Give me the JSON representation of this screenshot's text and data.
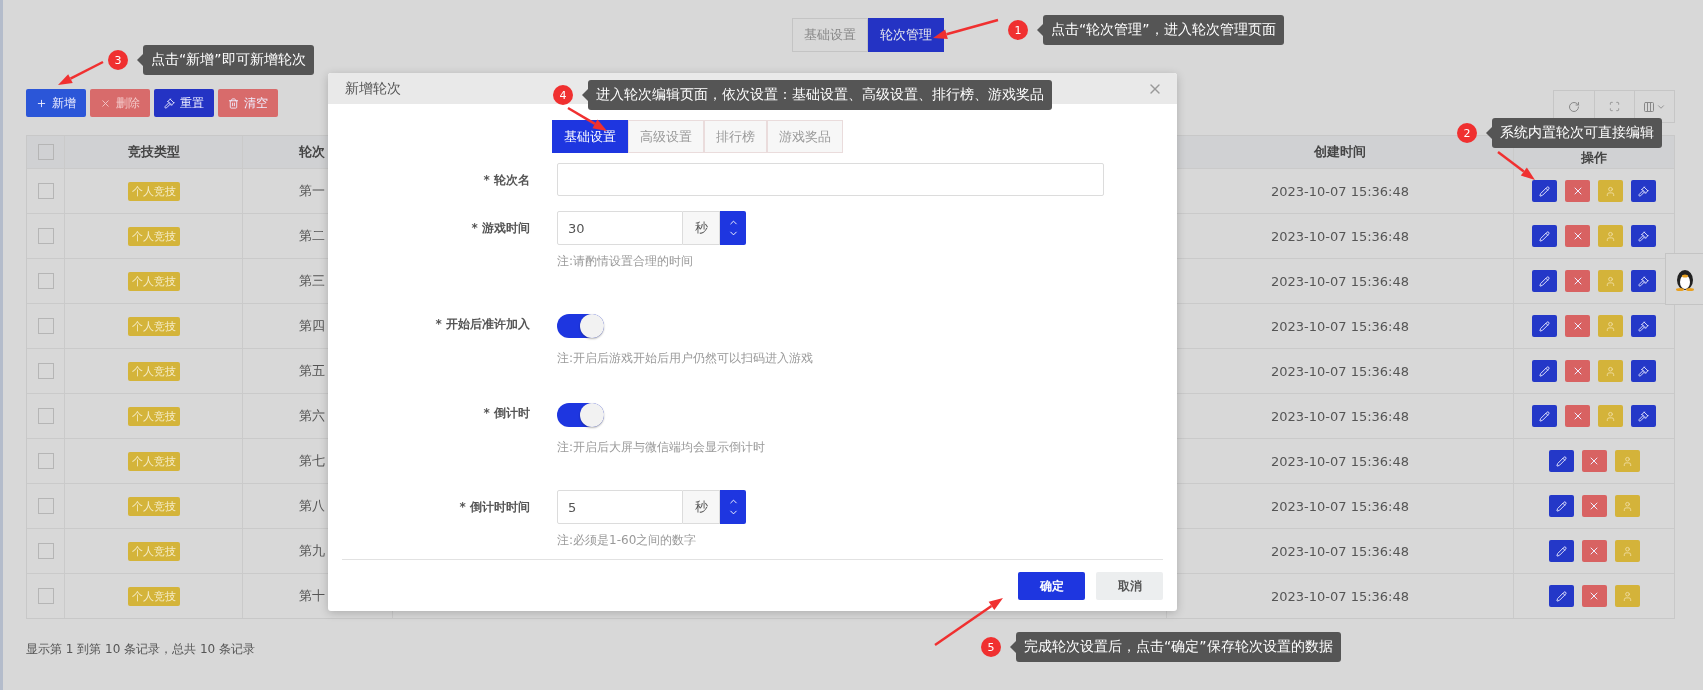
{
  "top_tabs": [
    {
      "label": "基础设置",
      "selected": false
    },
    {
      "label": "轮次管理",
      "selected": true
    }
  ],
  "toolbar": [
    {
      "kind": "add",
      "label": "新增"
    },
    {
      "kind": "delete",
      "label": "删除"
    },
    {
      "kind": "reset",
      "label": "重置"
    },
    {
      "kind": "clear",
      "label": "清空"
    }
  ],
  "table": {
    "select_all_checked": false,
    "columns": [
      "竞技类型",
      "轮次",
      "创建时间",
      "操作"
    ],
    "rows": [
      {
        "checked": false,
        "type": "个人竞技",
        "round": "第一",
        "created": "2023-10-07 15:36:48",
        "builtin": true
      },
      {
        "checked": false,
        "type": "个人竞技",
        "round": "第二",
        "created": "2023-10-07 15:36:48",
        "builtin": true
      },
      {
        "checked": false,
        "type": "个人竞技",
        "round": "第三",
        "created": "2023-10-07 15:36:48",
        "builtin": true
      },
      {
        "checked": false,
        "type": "个人竞技",
        "round": "第四",
        "created": "2023-10-07 15:36:48",
        "builtin": true
      },
      {
        "checked": false,
        "type": "个人竞技",
        "round": "第五",
        "created": "2023-10-07 15:36:48",
        "builtin": true
      },
      {
        "checked": false,
        "type": "个人竞技",
        "round": "第六",
        "created": "2023-10-07 15:36:48",
        "builtin": true
      },
      {
        "checked": false,
        "type": "个人竞技",
        "round": "第七",
        "created": "2023-10-07 15:36:48",
        "builtin": false
      },
      {
        "checked": false,
        "type": "个人竞技",
        "round": "第八",
        "created": "2023-10-07 15:36:48",
        "builtin": false
      },
      {
        "checked": false,
        "type": "个人竞技",
        "round": "第九",
        "created": "2023-10-07 15:36:48",
        "builtin": false
      },
      {
        "checked": false,
        "type": "个人竞技",
        "round": "第十",
        "created": "2023-10-07 15:36:48",
        "builtin": false
      }
    ]
  },
  "pagination_text": "显示第 1 到第 10 条记录，总共 10 条记录",
  "modal": {
    "title": "新增轮次",
    "tabs": [
      {
        "label": "基础设置",
        "selected": true
      },
      {
        "label": "高级设置",
        "selected": false
      },
      {
        "label": "排行榜",
        "selected": false
      },
      {
        "label": "游戏奖品",
        "selected": false
      }
    ],
    "fields": [
      {
        "kind": "text",
        "label": "* 轮次名"
      },
      {
        "kind": "number",
        "label": "* 游戏时间",
        "value": "30",
        "unit": "秒",
        "hint": "注:请酌情设置合理的时间"
      },
      {
        "kind": "switch",
        "label": "* 开始后准许加入",
        "on": true,
        "hint": "注:开启后游戏开始后用户仍然可以扫码进入游戏"
      },
      {
        "kind": "switch",
        "label": "* 倒计时",
        "on": true,
        "hint": "注:开启后大屏与微信端均会显示倒计时"
      },
      {
        "kind": "number",
        "label": "* 倒计时时间",
        "value": "5",
        "unit": "秒",
        "hint": "注:必须是1-60之间的数字"
      }
    ],
    "buttons": [
      {
        "label": "确定",
        "primary": true
      },
      {
        "label": "取消",
        "primary": false
      }
    ]
  },
  "annotations": [
    {
      "number": "1",
      "text": "点击“轮次管理”，进入轮次管理页面"
    },
    {
      "number": "2",
      "text": "系统内置轮次可直接编辑"
    },
    {
      "number": "3",
      "text": "点击“新增”即可新增轮次"
    },
    {
      "number": "4",
      "text": "进入轮次编辑页面，依次设置：基础设置、高级设置、排行榜、游戏奖品"
    },
    {
      "number": "5",
      "text": "完成轮次设置后，点击“确定”保存轮次设置的数据"
    }
  ]
}
